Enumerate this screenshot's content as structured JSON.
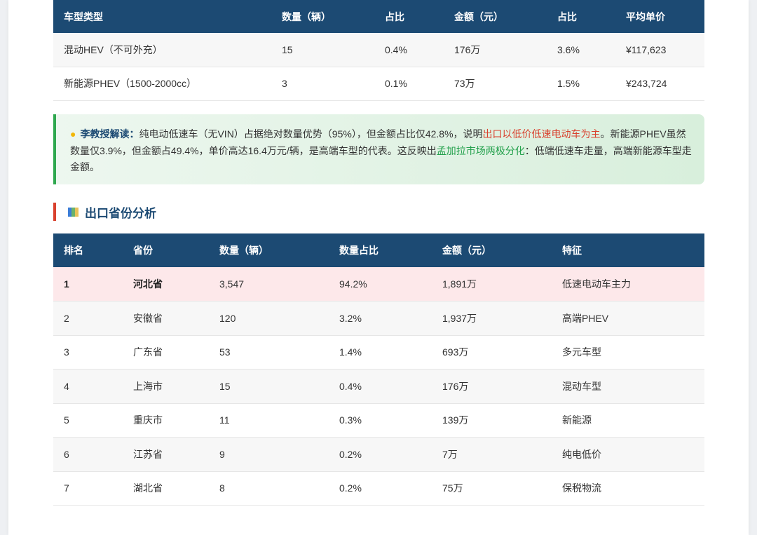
{
  "vehicle_table": {
    "headers": [
      "车型类型",
      "数量（辆）",
      "占比",
      "金额（元）",
      "占比",
      "平均单价"
    ],
    "rows": [
      [
        "混动HEV（不可外充）",
        "15",
        "0.4%",
        "176万",
        "3.6%",
        "¥117,623"
      ],
      [
        "新能源PHEV（1500-2000cc）",
        "3",
        "0.1%",
        "73万",
        "1.5%",
        "¥243,724"
      ]
    ]
  },
  "insight": {
    "icon": "lightbulb-icon",
    "author": "李教授解读",
    "sep": "：",
    "text1": "纯电动低速车（无VIN）占据绝对数量优势（95%），但金额占比仅42.8%，说明",
    "highlight1": "出口以低价低速电动车为主",
    "text2": "。新能源PHEV虽然数量仅3.9%，但金额占49.4%，单价高达16.4万元/辆，是高端车型的代表。这反映出",
    "highlight2": "孟加拉市场两极分化",
    "text3": "：低端低速车走量，高端新能源车型走金额。",
    "colors": {
      "red": "#d9412e",
      "green": "#22a04b"
    }
  },
  "section": {
    "title": "出口省份分析",
    "icon": "map-icon"
  },
  "province_table": {
    "headers": [
      "排名",
      "省份",
      "数量（辆）",
      "数量占比",
      "金额（元）",
      "特征"
    ],
    "rows": [
      [
        "1",
        "河北省",
        "3,547",
        "94.2%",
        "1,891万",
        "低速电动车主力"
      ],
      [
        "2",
        "安徽省",
        "120",
        "3.2%",
        "1,937万",
        "高端PHEV"
      ],
      [
        "3",
        "广东省",
        "53",
        "1.4%",
        "693万",
        "多元车型"
      ],
      [
        "4",
        "上海市",
        "15",
        "0.4%",
        "176万",
        "混动车型"
      ],
      [
        "5",
        "重庆市",
        "11",
        "0.3%",
        "139万",
        "新能源"
      ],
      [
        "6",
        "江苏省",
        "9",
        "0.2%",
        "7万",
        "纯电低价"
      ],
      [
        "7",
        "湖北省",
        "8",
        "0.2%",
        "75万",
        "保税物流"
      ]
    ]
  },
  "colors": {
    "header_bg": "#1c4a73",
    "highlight_row": "#fde8ea",
    "accent_red": "#d9412e",
    "accent_green": "#2fa84f"
  }
}
